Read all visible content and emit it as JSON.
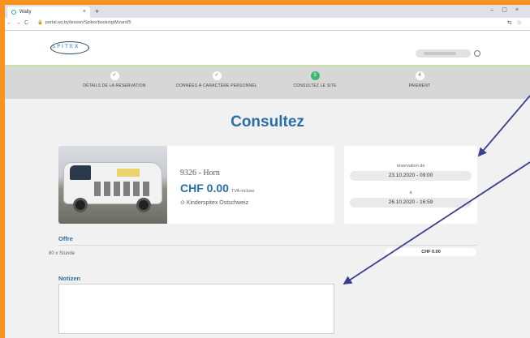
{
  "browser": {
    "tab_title": "Wally",
    "tab_close": "×",
    "new_tab": "+",
    "window_controls": "–▢×",
    "nav_controls": "←→C",
    "url": "portal.wy.by/lesson/Spitex/bookingWizard/5",
    "addr_icons": "⇆☆"
  },
  "header": {
    "logo_text": "SPITEX",
    "user_icon": "user-icon"
  },
  "stepper": {
    "steps": [
      {
        "icon": "✓",
        "label": "DÉTAILS DE LA RÉSERVATION"
      },
      {
        "icon": "✓",
        "label": "DONNÉES À CARACTÈRE PERSONNEL"
      },
      {
        "icon": "3",
        "label": "CONSULTEZ LE SITE"
      },
      {
        "icon": "4",
        "label": "PAIEMENT"
      }
    ]
  },
  "main": {
    "title": "Consultez",
    "location_name": "9326 - Horn",
    "price": "CHF 0.00",
    "price_note": "TVA incluse",
    "organization": "Kinderspitex Ostschweiz",
    "reservation_from_label": "réservation de",
    "reservation_from": "23.10.2020 - 09:00",
    "reservation_to_label": "à",
    "reservation_to": "26.10.2020 - 16:59",
    "offer_title": "Offre",
    "offer_item": "80 x Stunde",
    "offer_price": "CHF 0.00",
    "notes_title": "Notizen"
  },
  "colors": {
    "accent": "#2a6fa6",
    "active_step": "#3fb873",
    "frame": "#f7931e",
    "annotation_arrow": "#3b3f8f"
  }
}
